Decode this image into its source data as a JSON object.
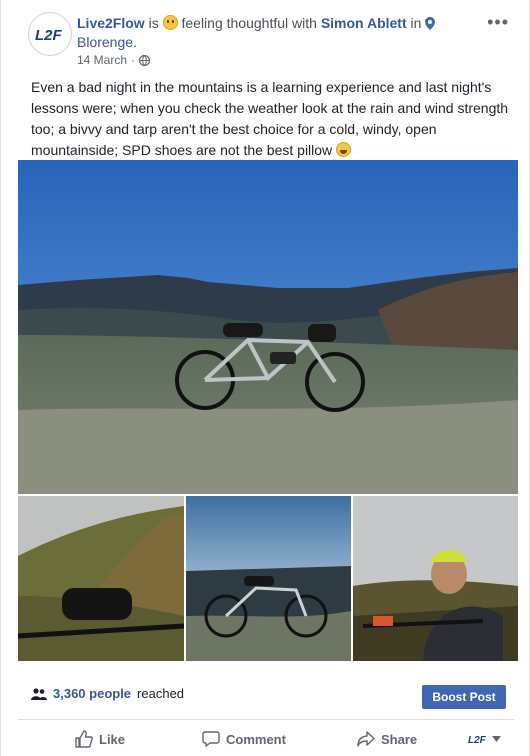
{
  "post": {
    "author": "Live2Flow",
    "is_text": "is",
    "feeling": "feeling thoughtful with",
    "with_person": "Simon Ablett",
    "in_text": "in",
    "place": "Blorenge.",
    "date": "14 March",
    "separator": "·",
    "avatar_text": "L2F",
    "body": "Even a bad night in the mountains is a learning experience and last night's lessons were; when you check the weather look at the rain and wind strength too; a bivvy and tarp aren't the best choice for a cold, windy, open mountainside; SPD shoes are not the best pillow"
  },
  "stats": {
    "reach_count": "3,360 people",
    "reach_label": "reached"
  },
  "buttons": {
    "boost": "Boost Post",
    "like": "Like",
    "comment": "Comment",
    "share": "Share"
  },
  "colors": {
    "link": "#365899",
    "primary": "#4267b2"
  },
  "icons": [
    "more-icon",
    "emoji-face-icon",
    "location-pin-icon",
    "globe-icon",
    "laughing-emoji-icon",
    "people-icon",
    "like-icon",
    "comment-icon",
    "share-icon",
    "page-avatar-icon",
    "chevron-down-icon"
  ]
}
